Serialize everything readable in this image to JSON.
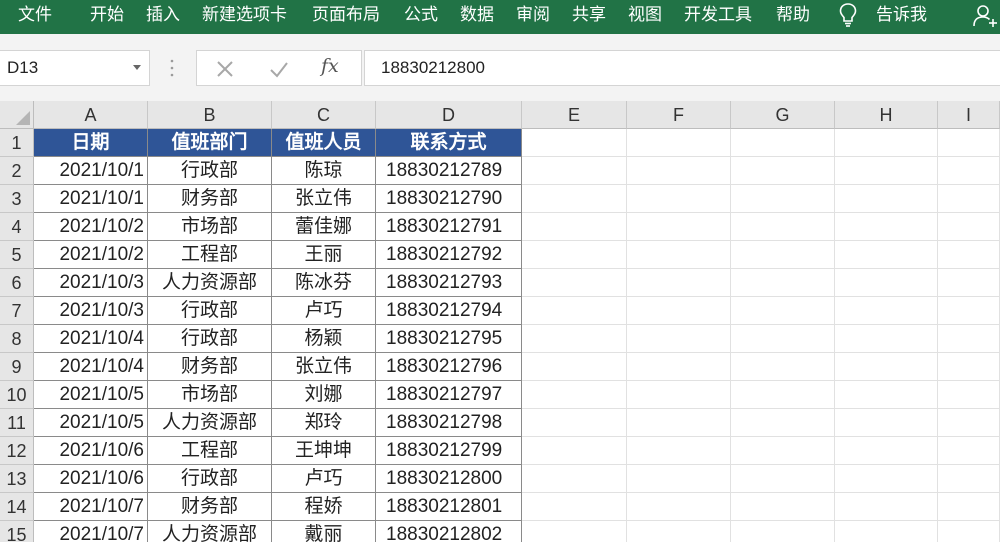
{
  "ribbon": {
    "tabs": [
      "文件",
      "开始",
      "插入",
      "新建选项卡",
      "页面布局",
      "公式",
      "数据",
      "审阅",
      "共享",
      "视图",
      "开发工具",
      "帮助"
    ],
    "tell_me": "告诉我"
  },
  "formula_bar": {
    "name_box": "D13",
    "fx_label": "fx",
    "formula": "18830212800"
  },
  "columns": [
    "A",
    "B",
    "C",
    "D",
    "E",
    "F",
    "G",
    "H",
    "I"
  ],
  "header_row": {
    "row": "1",
    "cells": [
      "日期",
      "值班部门",
      "值班人员",
      "联系方式"
    ]
  },
  "rows": [
    {
      "row": "2",
      "date": "2021/10/1",
      "dept": "行政部",
      "person": "陈琼",
      "phone": "18830212789"
    },
    {
      "row": "3",
      "date": "2021/10/1",
      "dept": "财务部",
      "person": "张立伟",
      "phone": "18830212790"
    },
    {
      "row": "4",
      "date": "2021/10/2",
      "dept": "市场部",
      "person": "蕾佳娜",
      "phone": "18830212791"
    },
    {
      "row": "5",
      "date": "2021/10/2",
      "dept": "工程部",
      "person": "王丽",
      "phone": "18830212792"
    },
    {
      "row": "6",
      "date": "2021/10/3",
      "dept": "人力资源部",
      "person": "陈冰芬",
      "phone": "18830212793"
    },
    {
      "row": "7",
      "date": "2021/10/3",
      "dept": "行政部",
      "person": "卢巧",
      "phone": "18830212794"
    },
    {
      "row": "8",
      "date": "2021/10/4",
      "dept": "行政部",
      "person": "杨颖",
      "phone": "18830212795"
    },
    {
      "row": "9",
      "date": "2021/10/4",
      "dept": "财务部",
      "person": "张立伟",
      "phone": "18830212796"
    },
    {
      "row": "10",
      "date": "2021/10/5",
      "dept": "市场部",
      "person": "刘娜",
      "phone": "18830212797"
    },
    {
      "row": "11",
      "date": "2021/10/5",
      "dept": "人力资源部",
      "person": "郑玲",
      "phone": "18830212798"
    },
    {
      "row": "12",
      "date": "2021/10/6",
      "dept": "工程部",
      "person": "王坤坤",
      "phone": "18830212799"
    },
    {
      "row": "13",
      "date": "2021/10/6",
      "dept": "行政部",
      "person": "卢巧",
      "phone": "18830212800"
    },
    {
      "row": "14",
      "date": "2021/10/7",
      "dept": "财务部",
      "person": "程娇",
      "phone": "18830212801"
    },
    {
      "row": "15",
      "date": "2021/10/7",
      "dept": "人力资源部",
      "person": "戴丽",
      "phone": "18830212802"
    }
  ],
  "colors": {
    "ribbon": "#217346",
    "table_header": "#2f5597"
  },
  "icons": [
    "lightbulb-icon",
    "share-user-icon",
    "cancel-x-icon",
    "confirm-check-icon",
    "insert-function-icon",
    "dropdown-arrow-icon"
  ]
}
